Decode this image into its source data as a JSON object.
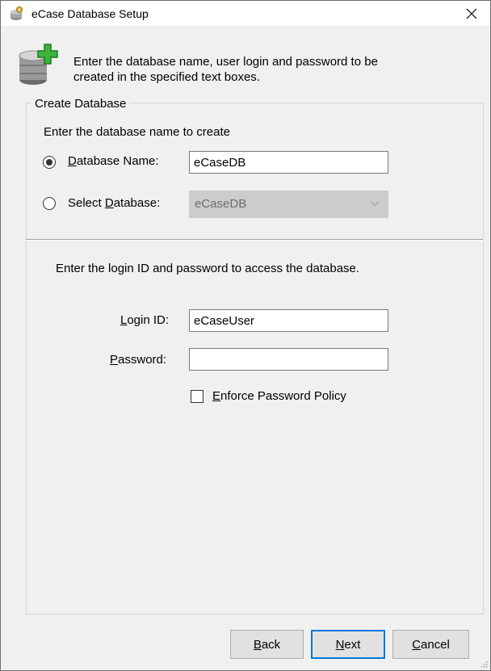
{
  "window": {
    "title": "eCase Database Setup"
  },
  "header": {
    "line1": "Enter the database name, user login and password to be",
    "line2": "created in the specified text boxes."
  },
  "create_db": {
    "legend": "Create Database",
    "instruction": "Enter the database name to create",
    "db_name_label_ul": "D",
    "db_name_label_rest": "atabase Name:",
    "db_name_value": "eCaseDB",
    "db_name_selected": true,
    "select_label_pre": "Select ",
    "select_label_ul": "D",
    "select_label_rest": "atabase:",
    "select_value": "eCaseDB"
  },
  "login": {
    "instruction": "Enter the login ID and password to access the database.",
    "login_label_ul": "L",
    "login_label_rest": "ogin ID:",
    "login_value": "eCaseUser",
    "password_label_ul": "P",
    "password_label_rest": "assword:",
    "password_value": "",
    "policy_label_ul": "E",
    "policy_label_rest": "nforce Password Policy",
    "policy_checked": false
  },
  "buttons": {
    "back_ul": "B",
    "back_rest": "ack",
    "next_ul": "N",
    "next_rest": "ext",
    "cancel_ul": "C",
    "cancel_rest": "ancel"
  },
  "icons": {
    "title": "database-key-icon",
    "header": "database-add-icon",
    "close": "close-icon"
  },
  "colors": {
    "accent": "#0078d7",
    "plus_green": "#3cb43c"
  }
}
